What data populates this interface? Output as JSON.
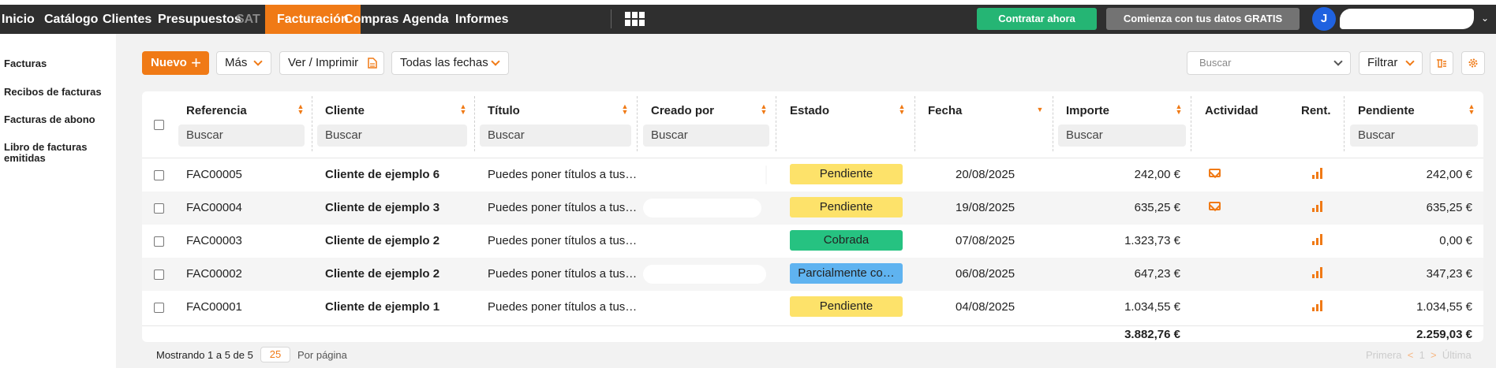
{
  "nav": {
    "items": [
      "Inicio",
      "Catálogo",
      "Clientes",
      "Presupuestos",
      "SAT",
      "Facturación",
      "Compras",
      "Agenda",
      "Informes"
    ],
    "cta_contract": "Contratar ahora",
    "cta_free": "Comienza con tus datos GRATIS",
    "avatar_initial": "J",
    "colors": {
      "bar": "#2f2f2f",
      "active": "#f07a16",
      "contract": "#25b574",
      "free": "#737373",
      "avatar": "#1f62e0"
    }
  },
  "sidebar": {
    "items": [
      "Facturas",
      "Recibos de facturas",
      "Facturas de abono",
      "Libro de facturas emitidas"
    ]
  },
  "toolbar": {
    "new_label": "Nuevo",
    "more_label": "Más",
    "print_label": "Ver / Imprimir",
    "dates_label": "Todas las fechas",
    "search_placeholder": "Buscar",
    "filter_label": "Filtrar",
    "icons": [
      "document-icon",
      "chevron-down-icon",
      "trash-columns-icon",
      "gear-icon"
    ]
  },
  "table": {
    "columns": [
      "Referencia",
      "Cliente",
      "Título",
      "Creado por",
      "Estado",
      "Fecha",
      "Importe",
      "Actividad",
      "Rent.",
      "Pendiente"
    ],
    "search_placeholder": "Buscar",
    "rows": [
      {
        "ref": "FAC00005",
        "client": "Cliente de ejemplo 6",
        "title": "Puedes poner títulos a tus…",
        "status": "Pendiente",
        "status_color": "#fde26a",
        "date": "20/08/2025",
        "amount": "242,00 €",
        "activity": "envelope-icon",
        "pending": "242,00 €"
      },
      {
        "ref": "FAC00004",
        "client": "Cliente de ejemplo 3",
        "title": "Puedes poner títulos a tus…",
        "status": "Pendiente",
        "status_color": "#fde26a",
        "date": "19/08/2025",
        "amount": "635,25 €",
        "activity": "envelope-icon",
        "pending": "635,25 €"
      },
      {
        "ref": "FAC00003",
        "client": "Cliente de ejemplo 2",
        "title": "Puedes poner títulos a tus…",
        "status": "Cobrada",
        "status_color": "#26c281",
        "date": "07/08/2025",
        "amount": "1.323,73 €",
        "activity": "",
        "pending": "0,00 €"
      },
      {
        "ref": "FAC00002",
        "client": "Cliente de ejemplo 2",
        "title": "Puedes poner títulos a tus…",
        "status": "Parcialmente co…",
        "status_color": "#5fb3f0",
        "date": "06/08/2025",
        "amount": "647,23 €",
        "activity": "",
        "pending": "347,23 €"
      },
      {
        "ref": "FAC00001",
        "client": "Cliente de ejemplo 1",
        "title": "Puedes poner títulos a tus…",
        "status": "Pendiente",
        "status_color": "#fde26a",
        "date": "04/08/2025",
        "amount": "1.034,55 €",
        "activity": "",
        "pending": "1.034,55 €"
      }
    ],
    "total_amount": "3.882,76 €",
    "total_pending": "2.259,03 €"
  },
  "footer": {
    "showing": "Mostrando 1 a 5 de 5",
    "per_page_value": "25",
    "per_page_label": "Por página",
    "pager_first": "Primera",
    "pager_prev": "<",
    "pager_page": "1",
    "pager_next": ">",
    "pager_last": "Última"
  }
}
